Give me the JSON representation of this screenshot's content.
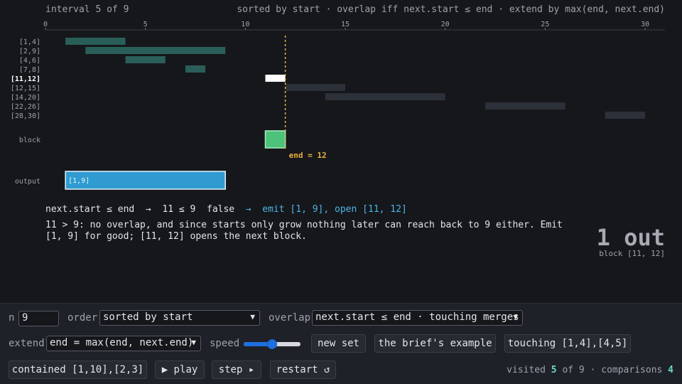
{
  "header": {
    "interval_text": "interval 5 of 9",
    "rule_text": "sorted by start · overlap iff next.start ≤ end · extend by max(end, next.end)"
  },
  "chart_data": {
    "type": "interval-timeline",
    "axis_ticks": [
      0,
      5,
      10,
      15,
      20,
      25,
      30
    ],
    "xlim": [
      0,
      30
    ],
    "intervals": [
      {
        "label": "[1,4]",
        "start": 1,
        "end": 4,
        "state": "merged"
      },
      {
        "label": "[2,9]",
        "start": 2,
        "end": 9,
        "state": "merged"
      },
      {
        "label": "[4,6]",
        "start": 4,
        "end": 6,
        "state": "merged"
      },
      {
        "label": "[7,8]",
        "start": 7,
        "end": 8,
        "state": "merged"
      },
      {
        "label": "[11,12]",
        "start": 11,
        "end": 12,
        "state": "current"
      },
      {
        "label": "[12,15]",
        "start": 12,
        "end": 15,
        "state": "pending"
      },
      {
        "label": "[14,20]",
        "start": 14,
        "end": 20,
        "state": "pending"
      },
      {
        "label": "[22,26]",
        "start": 22,
        "end": 26,
        "state": "pending"
      },
      {
        "label": "[28,30]",
        "start": 28,
        "end": 30,
        "state": "pending"
      }
    ],
    "block": {
      "label": "block",
      "start": 11,
      "end": 12
    },
    "end_marker": {
      "value": 12,
      "text": "end = 12"
    },
    "output": {
      "label": "output",
      "items": [
        {
          "text": "[1,9]",
          "start": 1,
          "end": 9
        }
      ]
    },
    "colors": {
      "merged": "#2a5f59",
      "current": "#ffffff",
      "pending": "#2c3038",
      "block": "#4cc27a",
      "output": "#2f9bd0",
      "marker": "#e8b040"
    }
  },
  "status": {
    "condition": "next.start ≤ end",
    "arrow": "→",
    "evaluation": "11 ≤ 9",
    "result": "false",
    "arrow2": "→",
    "action": "emit [1, 9], open [11, 12]",
    "explanation": "11 > 9: no overlap, and since starts only grow nothing later can reach back to 9 either. Emit [1, 9] for good; [11, 12] opens the next block."
  },
  "summary": {
    "count_text": "1 out",
    "block_text": "block [11, 12]"
  },
  "controls": {
    "n_label": "n",
    "n_value": "9",
    "order_label": "order",
    "order_value": "sorted by start",
    "overlap_label": "overlap",
    "overlap_value": "next.start ≤ end · touching merges",
    "extend_label": "extend",
    "extend_value": "end = max(end, next.end)",
    "speed_label": "speed",
    "speed_level": 0.5,
    "new_set": "new set",
    "briefs_example": "the brief's example",
    "touching": "touching [1,4],[4,5]",
    "contained": "contained [1,10],[2,3]",
    "play": "▶ play",
    "step": "step ▸",
    "restart": "restart ↺",
    "visited_prefix": "visited",
    "visited_count": "5",
    "visited_of": "of 9 ·",
    "comparisons_label": "comparisons",
    "comparisons_count": "4"
  }
}
